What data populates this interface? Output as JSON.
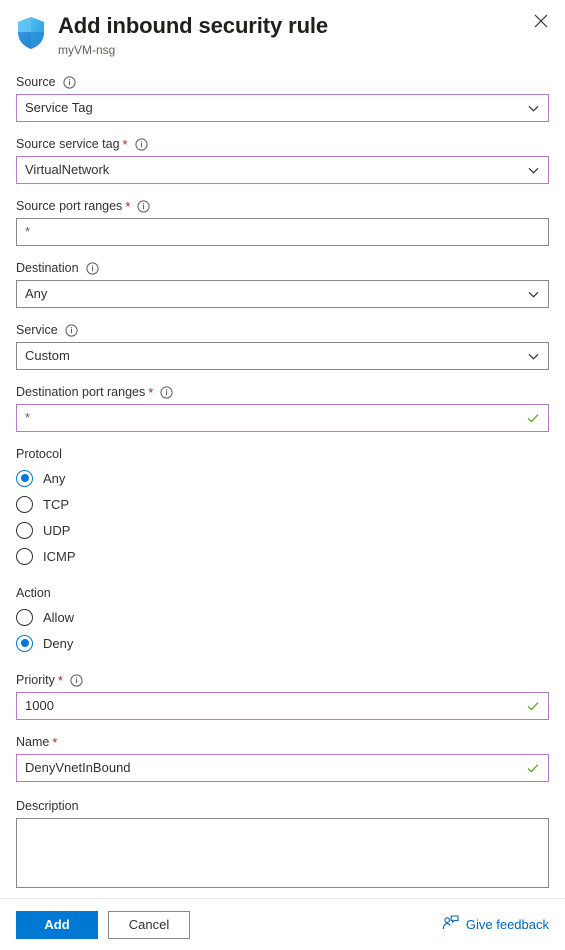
{
  "header": {
    "icon": "shield-icon",
    "title": "Add inbound security rule",
    "subtitle": "myVM-nsg",
    "close_icon": "close-icon"
  },
  "form": {
    "fields": [
      {
        "label": "Source",
        "required": false,
        "info": true,
        "type": "dropdown",
        "value": "Service Tag",
        "border": "purple",
        "valid": false
      },
      {
        "label": "Source service tag",
        "required": true,
        "info": true,
        "type": "dropdown",
        "value": "VirtualNetwork",
        "border": "purple",
        "valid": false
      },
      {
        "label": "Source port ranges",
        "required": true,
        "info": true,
        "type": "text",
        "value": "*",
        "border": "gray",
        "valid": false
      },
      {
        "label": "Destination",
        "required": false,
        "info": true,
        "type": "dropdown",
        "value": "Any",
        "border": "gray",
        "valid": false
      },
      {
        "label": "Service",
        "required": false,
        "info": true,
        "type": "dropdown",
        "value": "Custom",
        "border": "gray",
        "valid": false
      },
      {
        "label": "Destination port ranges",
        "required": true,
        "info": true,
        "type": "text",
        "value": "*",
        "border": "purple",
        "valid": true
      }
    ],
    "protocol": {
      "label": "Protocol",
      "options": [
        {
          "label": "Any",
          "selected": true
        },
        {
          "label": "TCP",
          "selected": false
        },
        {
          "label": "UDP",
          "selected": false
        },
        {
          "label": "ICMP",
          "selected": false
        }
      ]
    },
    "action": {
      "label": "Action",
      "options": [
        {
          "label": "Allow",
          "selected": false
        },
        {
          "label": "Deny",
          "selected": true
        }
      ]
    },
    "priority": {
      "label": "Priority",
      "required": true,
      "info": true,
      "value": "1000",
      "border": "purple",
      "valid": true
    },
    "name": {
      "label": "Name",
      "required": true,
      "info": false,
      "value": "DenyVnetInBound",
      "border": "purple",
      "valid": true
    },
    "description": {
      "label": "Description",
      "required": false,
      "info": false,
      "value": "",
      "placeholder": ""
    }
  },
  "footer": {
    "add_label": "Add",
    "cancel_label": "Cancel",
    "feedback_label": "Give feedback",
    "feedback_icon": "person-feedback-icon"
  },
  "colors": {
    "accent": "#0078d4",
    "focus_border": "#b27cc4",
    "valid_check": "#5ba832",
    "required_star": "#a4262c",
    "link": "#0067b8"
  }
}
